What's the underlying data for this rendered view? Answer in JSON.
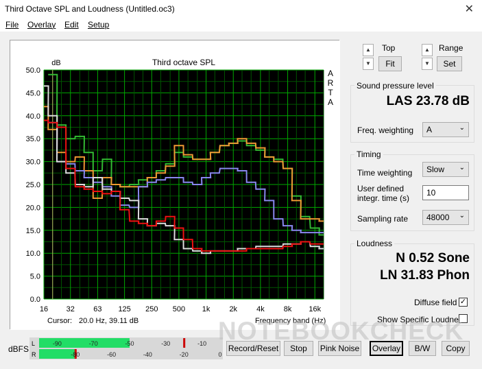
{
  "window": {
    "title": "Third Octave SPL and Loudness (Untitled.oc3)",
    "close_glyph": "✕"
  },
  "menu": {
    "file": "File",
    "overlay": "Overlay",
    "edit": "Edit",
    "setup": "Setup"
  },
  "graph": {
    "title": "Third octave SPL",
    "unit": "dB",
    "arta": [
      "A",
      "R",
      "T",
      "A"
    ],
    "y_ticks": [
      "50.0",
      "45.0",
      "40.0",
      "35.0",
      "30.0",
      "25.0",
      "20.0",
      "15.0",
      "10.0",
      "5.0",
      "0.0"
    ],
    "x_ticks": [
      "16",
      "32",
      "63",
      "125",
      "250",
      "500",
      "1k",
      "2k",
      "4k",
      "8k",
      "16k"
    ],
    "cursor_label": "Cursor:",
    "cursor_value": "20.0 Hz, 39.11 dB",
    "xaxis_label": "Frequency band (Hz)",
    "colors": {
      "bg": "#000000",
      "grid_major": "#00aa00",
      "grid_minor": "#005500"
    }
  },
  "chart_data": {
    "type": "line",
    "title": "Third octave SPL",
    "xlabel": "Frequency band (Hz)",
    "ylabel": "dB",
    "ylim": [
      0,
      50
    ],
    "grid": true,
    "x": [
      16,
      20,
      25,
      31.5,
      40,
      50,
      63,
      80,
      100,
      125,
      160,
      200,
      250,
      315,
      400,
      500,
      630,
      800,
      1000,
      1250,
      1600,
      2000,
      2500,
      3150,
      4000,
      5000,
      6300,
      8000,
      10000,
      12500,
      16000,
      20000
    ],
    "series": [
      {
        "name": "",
        "color": "#33bb33",
        "values": [
          null,
          49,
          38,
          35,
          35.5,
          32,
          28,
          30.5,
          25,
          24.5,
          25,
          26,
          26.5,
          28,
          29.5,
          32,
          31,
          30.5,
          30.5,
          32,
          33.5,
          34,
          34.5,
          33.5,
          32.5,
          31,
          30.5,
          28.5,
          22.5,
          18,
          15.5,
          14
        ]
      },
      {
        "name": "",
        "color": "#ee9933",
        "values": [
          42,
          37,
          32,
          30,
          31,
          28,
          22,
          26.5,
          25,
          24.5,
          24.5,
          24.5,
          26.5,
          27.5,
          29,
          33.5,
          31.5,
          30.5,
          30.5,
          32,
          33.5,
          34,
          35,
          34,
          33,
          31,
          30,
          28.5,
          21.5,
          17.5,
          17.5,
          17
        ]
      },
      {
        "name": "",
        "color": "#8888ee",
        "values": [
          39,
          38.5,
          30,
          29.5,
          28,
          26.5,
          25.5,
          24.5,
          22.5,
          20.5,
          20,
          24.5,
          25.5,
          26,
          26.5,
          26.5,
          25.5,
          25,
          26.5,
          27.5,
          28.5,
          28.5,
          28,
          25.5,
          24,
          21.5,
          17.5,
          16,
          15,
          14.5,
          14.5,
          14.5
        ]
      },
      {
        "name": "",
        "color": "#dddddd",
        "values": [
          46.5,
          40,
          30,
          27.5,
          25,
          24.5,
          26.5,
          24,
          23.5,
          22,
          21.5,
          17.5,
          16,
          16.5,
          16,
          13,
          11,
          10.5,
          10,
          10.5,
          10.5,
          10.5,
          11,
          11,
          11.5,
          11.5,
          11.5,
          12,
          12,
          12.5,
          11.5,
          11
        ]
      },
      {
        "name": "",
        "color": "#ee1111",
        "values": [
          39,
          38.5,
          37.5,
          28.5,
          24.5,
          24,
          23.5,
          23,
          23.5,
          19.5,
          17,
          16.5,
          16,
          17,
          18,
          15.5,
          13,
          11,
          10.5,
          10.5,
          10.5,
          10.5,
          10.5,
          11,
          11,
          11,
          11,
          11.5,
          12,
          12.5,
          12,
          12
        ]
      }
    ]
  },
  "controls": {
    "top_label": "Top",
    "fit_label": "Fit",
    "range_label": "Range",
    "set_label": "Set",
    "spin_up": "▲",
    "spin_down": "▼"
  },
  "spl": {
    "group_title": "Sound pressure level",
    "value": "LAS 23.78 dB",
    "freq_weighting_label": "Freq. weighting",
    "freq_weighting_value": "A"
  },
  "timing": {
    "group_title": "Timing",
    "time_weighting_label": "Time weighting",
    "time_weighting_value": "Slow",
    "integr_label_1": "User defined",
    "integr_label_2": "integr. time (s)",
    "integr_value": "10",
    "sampling_label": "Sampling rate",
    "sampling_value": "48000"
  },
  "loudness": {
    "group_title": "Loudness",
    "sone": "N 0.52 Sone",
    "phon": "LN 31.83 Phon",
    "diffuse_label": "Diffuse field",
    "diffuse_checked": "✓",
    "specific_label": "Show Specific Loudness"
  },
  "meter": {
    "label": "dBFS",
    "L": "L",
    "R": "R",
    "top_ticks": [
      "-90",
      "-70",
      "-50",
      "-30",
      "-10"
    ],
    "bottom_ticks": [
      "-80",
      "-60",
      "-40",
      "-20",
      "0"
    ],
    "L_level": -50,
    "R_level": -80,
    "L_peak": -20,
    "R_peak": -80
  },
  "buttons": {
    "record": "Record/Reset",
    "stop": "Stop",
    "pink": "Pink Noise",
    "overlay": "Overlay",
    "bw": "B/W",
    "copy": "Copy"
  },
  "watermark": "NOTEBOOKCHECK"
}
